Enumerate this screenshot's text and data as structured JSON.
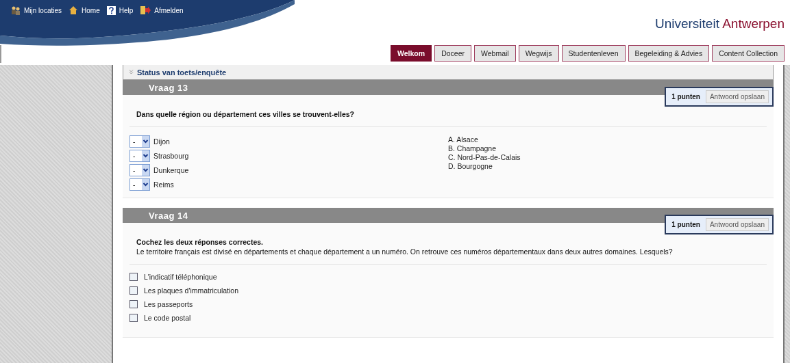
{
  "topbar": {
    "links": [
      {
        "label": "Mijn locaties"
      },
      {
        "label": "Home"
      },
      {
        "label": "Help"
      },
      {
        "label": "Afmelden"
      }
    ]
  },
  "brand": {
    "name": "Universiteit",
    "accent": "Antwerpen"
  },
  "tabs": [
    {
      "label": "Welkom",
      "selected": true
    },
    {
      "label": "Doceer",
      "selected": false
    },
    {
      "label": "Webmail",
      "selected": false
    },
    {
      "label": "Wegwijs",
      "selected": false
    },
    {
      "label": "Studentenleven",
      "selected": false
    },
    {
      "label": "Begeleiding & Advies",
      "selected": false
    },
    {
      "label": "Content Collection",
      "selected": false
    }
  ],
  "status_bar": {
    "label": "Status van toets/enquête",
    "expanded": false
  },
  "questions": [
    {
      "title": "Vraag 13",
      "points": "1 punten",
      "save": "Antwoord opslaan",
      "kind": "matching",
      "prompt": "Dans quelle région ou département ces villes se trouvent-elles?",
      "items": [
        {
          "value": "-",
          "label": "Dijon"
        },
        {
          "value": "-",
          "label": "Strasbourg"
        },
        {
          "value": "-",
          "label": "Dunkerque"
        },
        {
          "value": "-",
          "label": "Reims"
        }
      ],
      "answers": [
        "A. Alsace",
        "B. Champagne",
        "C. Nord-Pas-de-Calais",
        "D. Bourgogne"
      ]
    },
    {
      "title": "Vraag 14",
      "points": "1 punten",
      "save": "Antwoord opslaan",
      "kind": "multiple",
      "prompt": "Cochez les deux réponses correctes.",
      "text": "Le territoire français est divisé en départements et chaque département a un numéro. On retrouve ces numéros départementaux dans deux autres domaines. Lesquels?",
      "options": [
        {
          "label": "L'indicatif téléphonique",
          "checked": false
        },
        {
          "label": "Les plaques d'immatriculation",
          "checked": false
        },
        {
          "label": "Les passeports",
          "checked": false
        },
        {
          "label": "Le code postal",
          "checked": false
        }
      ]
    }
  ]
}
